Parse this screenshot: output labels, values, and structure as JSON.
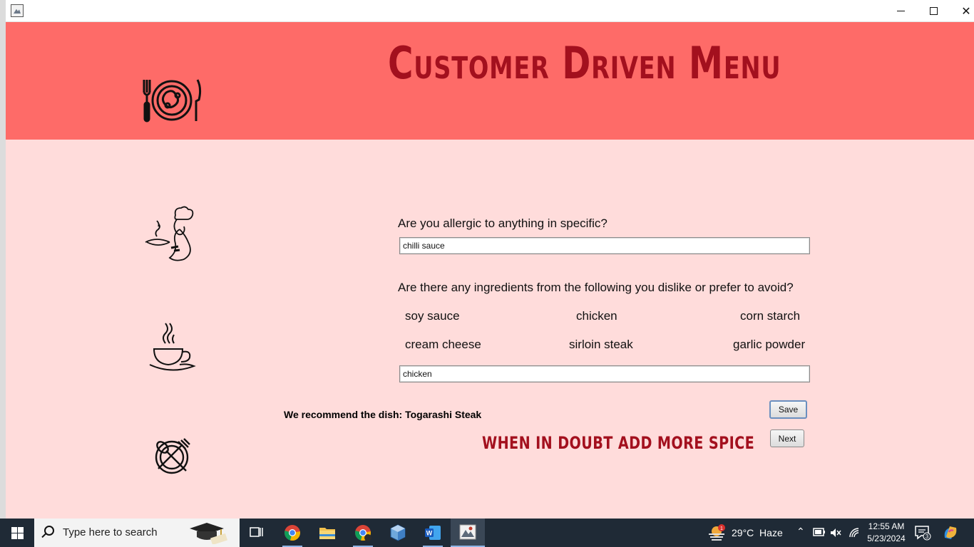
{
  "window": {
    "title": "",
    "controls": {
      "minimize": "minimize",
      "maximize": "maximize",
      "close": "✕"
    }
  },
  "banner": {
    "title": "Customer Driven Menu",
    "accent_color": "#fe6b68",
    "title_color": "#a3101e"
  },
  "form": {
    "question_allergy": "Are you allergic to anything in specific?",
    "allergy_value": "chilli sauce",
    "question_dislike": "Are there any ingredients from the following you dislike or prefer to avoid?",
    "ingredients": [
      "soy sauce",
      "chicken",
      "corn starch",
      "cream cheese",
      "sirloin steak",
      "garlic powder"
    ],
    "dislike_value": "chicken",
    "recommendation": "We recommend the dish: Togarashi Steak",
    "tagline": "WHEN IN DOUBT ADD MORE SPICE",
    "save_label": "Save",
    "next_label": "Next",
    "background_color": "#ffdcdb"
  },
  "taskbar": {
    "search_placeholder": "Type here to search",
    "weather": "29°C  Haze",
    "weather_badge": "1",
    "time": "12:55 AM",
    "date": "5/23/2024",
    "notifications_count": "3",
    "apps": [
      "task-view-icon",
      "chrome-icon",
      "file-explorer-icon",
      "chrome-profile-icon",
      "virtualbox-icon",
      "word-icon",
      "java-app-icon"
    ]
  }
}
